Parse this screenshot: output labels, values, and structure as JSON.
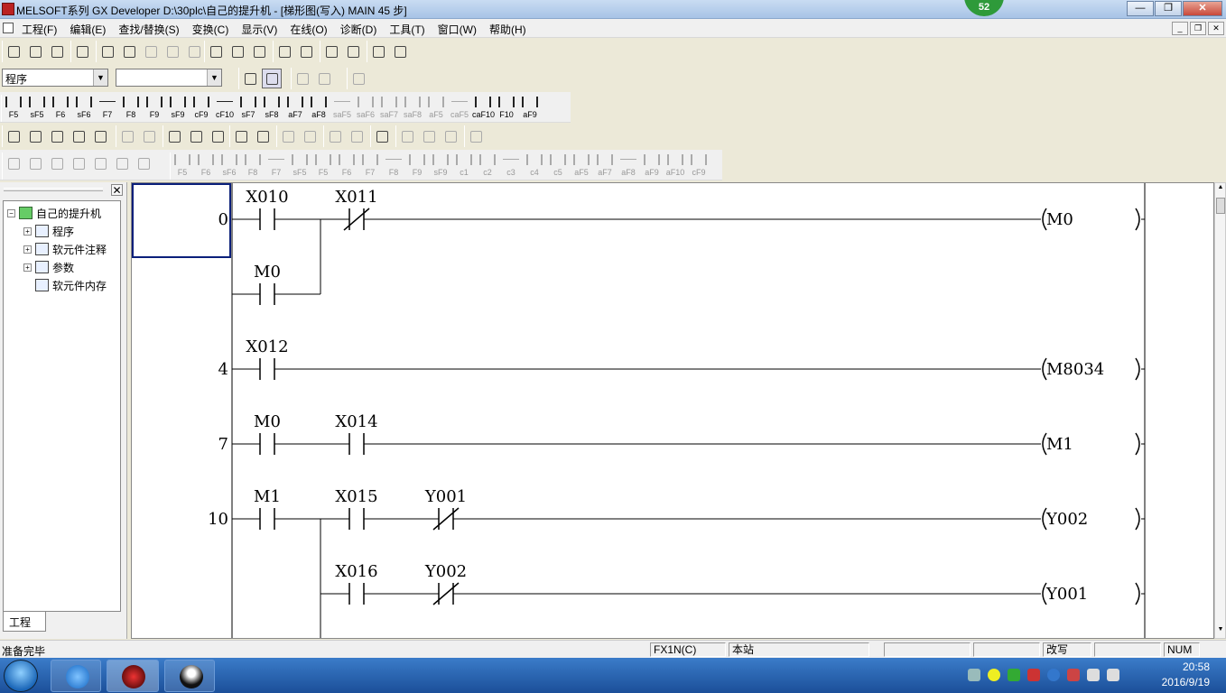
{
  "window": {
    "title": "MELSOFT系列 GX Developer D:\\30plc\\自己的提升机 - [梯形图(写入)    MAIN    45 步]",
    "badge": "52"
  },
  "menu": [
    "工程(F)",
    "编辑(E)",
    "查找/替换(S)",
    "变换(C)",
    "显示(V)",
    "在线(O)",
    "诊断(D)",
    "工具(T)",
    "窗口(W)",
    "帮助(H)"
  ],
  "combos": {
    "program_select": "程序",
    "second_select": ""
  },
  "ladder_keys": [
    "F5",
    "sF5",
    "F6",
    "sF6",
    "F7",
    "F8",
    "F9",
    "sF9",
    "cF9",
    "cF10",
    "sF7",
    "sF8",
    "aF7",
    "aF8",
    "saF5",
    "saF6",
    "saF7",
    "saF8",
    "aF5",
    "caF5",
    "caF10",
    "F10",
    "aF9"
  ],
  "ladder_keys_2": [
    "F5",
    "F6",
    "sF6",
    "F8",
    "F7",
    "sF5",
    "F5",
    "F6",
    "F7",
    "F8",
    "F9",
    "sF9",
    "c1",
    "c2",
    "c3",
    "c4",
    "c5",
    "aF5",
    "aF7",
    "aF8",
    "aF9",
    "aF10",
    "cF9"
  ],
  "tree": {
    "root": "自己的提升机",
    "items": [
      "程序",
      "软元件注释",
      "参数",
      "软元件内存"
    ],
    "tab": "工程"
  },
  "ladder": {
    "rungs": [
      {
        "step": "0",
        "contacts": [
          {
            "label": "X010",
            "type": "NO"
          },
          {
            "label": "X011",
            "type": "NC"
          }
        ],
        "coil": "M0",
        "branch": {
          "label": "M0",
          "type": "NO"
        }
      },
      {
        "step": "4",
        "contacts": [
          {
            "label": "X012",
            "type": "NO"
          }
        ],
        "coil": "M8034"
      },
      {
        "step": "7",
        "contacts": [
          {
            "label": "M0",
            "type": "NO"
          },
          {
            "label": "X014",
            "type": "NO"
          }
        ],
        "coil": "M1"
      },
      {
        "step": "10",
        "contacts": [
          {
            "label": "M1",
            "type": "NO"
          },
          {
            "label": "X015",
            "type": "NO"
          },
          {
            "label": "Y001",
            "type": "NC"
          }
        ],
        "coil": "Y002",
        "branch2": {
          "contacts": [
            {
              "label": "X016",
              "type": "NO"
            },
            {
              "label": "Y002",
              "type": "NC"
            }
          ],
          "coil": "Y001"
        }
      }
    ]
  },
  "status": {
    "message": "准备完毕",
    "plc": "FX1N(C)",
    "station": "本站",
    "mode": "改写",
    "num": "NUM"
  },
  "clock": {
    "time": "20:58",
    "date": "2016/9/19"
  }
}
